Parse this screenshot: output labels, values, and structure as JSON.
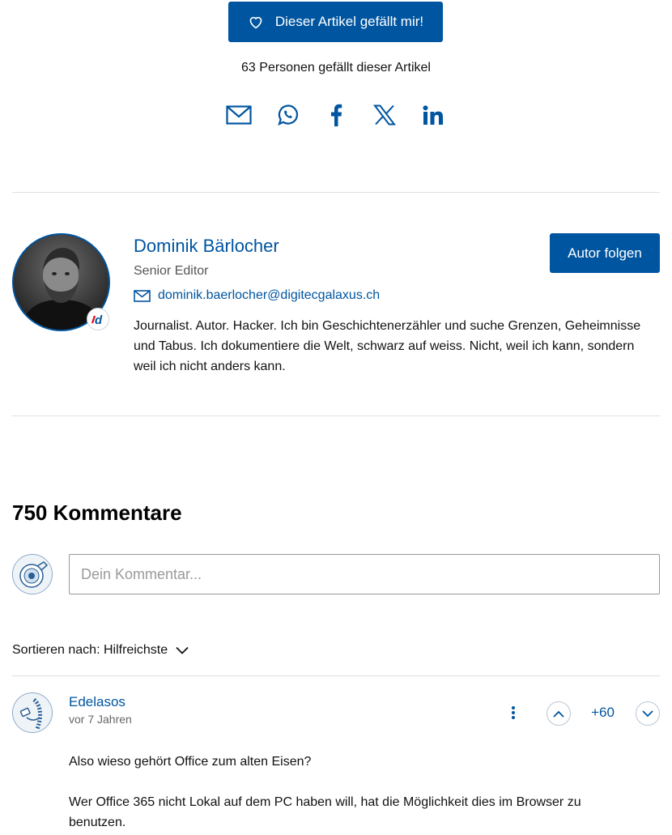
{
  "like": {
    "button_label": "Dieser Artikel gefällt mir!",
    "count_text": "63 Personen gefällt dieser Artikel"
  },
  "share": {
    "icons": [
      "mail-icon",
      "whatsapp-icon",
      "facebook-icon",
      "x-icon",
      "linkedin-icon"
    ]
  },
  "author": {
    "name": "Dominik Bärlocher",
    "role": "Senior Editor",
    "email": "dominik.baerlocher@digitecgalaxus.ch",
    "bio": "Journalist. Autor. Hacker. Ich bin Geschichtenerzähler und suche Grenzen, Geheimnisse und Tabus. Ich dokumentiere die Welt, schwarz auf weiss. Nicht, weil ich kann, sondern weil ich nicht anders kann.",
    "follow_label": "Autor folgen",
    "badge_letter": "d"
  },
  "comments": {
    "title": "750 Kommentare",
    "input_placeholder": "Dein Kommentar...",
    "sort_label": "Sortieren nach: Hilfreichste",
    "items": [
      {
        "user": "Edelasos",
        "time": "vor 7 Jahren",
        "votes": "+60",
        "paragraphs": [
          "Also wieso gehört Office zum alten Eisen?",
          "Wer Office 365 nicht Lokal auf dem PC haben will, hat die Möglichkeit dies im Browser zu benutzen."
        ]
      }
    ]
  },
  "colors": {
    "brand": "#0055a0",
    "divider": "#e0e0e0"
  }
}
